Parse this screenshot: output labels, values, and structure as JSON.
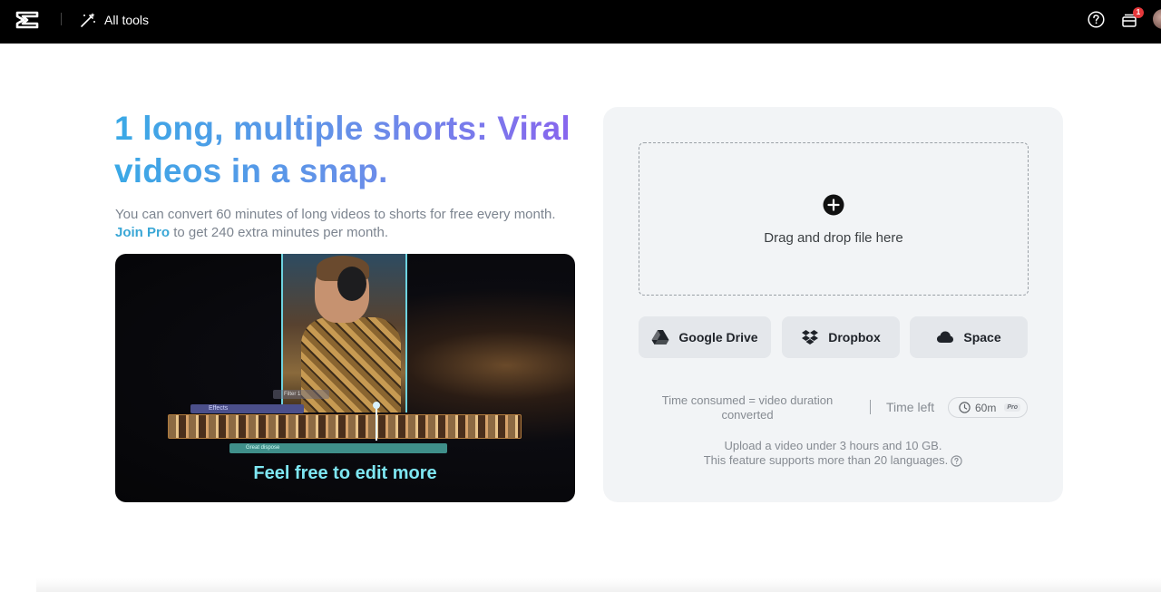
{
  "topbar": {
    "all_tools_label": "All tools",
    "notification_count": "1"
  },
  "hero": {
    "headline": "1 long, multiple shorts: Viral videos in a snap.",
    "subtext_before": "You can convert 60 minutes of long videos to shorts for free every month.",
    "join_pro_link": "Join Pro",
    "subtext_after": "to get 240 extra minutes per month."
  },
  "preview": {
    "caption": "Feel free to edit more",
    "track_effects": "Effects",
    "track_filter": "Filter 1",
    "track_audio": "Great dispose"
  },
  "upload": {
    "drop_label": "Drag and drop file here",
    "sources": [
      {
        "label": "Google Drive",
        "icon": "google-drive-icon"
      },
      {
        "label": "Dropbox",
        "icon": "dropbox-icon"
      },
      {
        "label": "Space",
        "icon": "cloud-icon"
      }
    ],
    "time_consumed_text": "Time consumed = video duration converted",
    "time_left_label": "Time left",
    "time_left_value": "60m",
    "pro_tag": "Pro",
    "limits_line1": "Upload a video under 3 hours and 10 GB.",
    "limits_line2": "This feature supports more than 20 languages."
  },
  "colors": {
    "headline_gradient_start": "#3aa9e6",
    "headline_gradient_end": "#8a63ee",
    "link": "#3aa7d6",
    "caption": "#7ee7f2",
    "card_bg": "#f2f4f6"
  }
}
